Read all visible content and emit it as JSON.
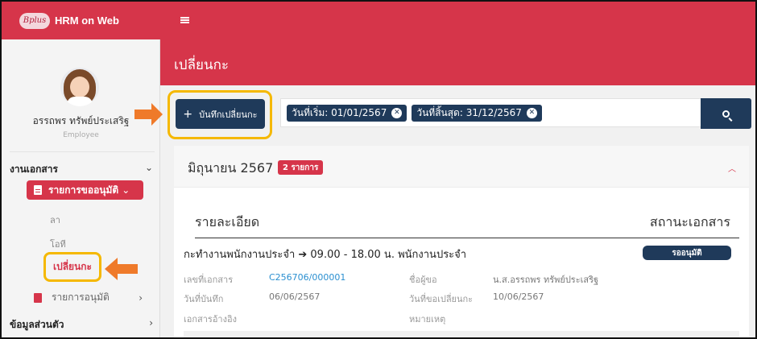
{
  "brand": {
    "logo_text": "Bplus",
    "app_name": "HRM on Web"
  },
  "user": {
    "name": "อรรถพร ทรัพย์ประเสริฐ",
    "role": "Employee"
  },
  "sidebar": {
    "section_documents": "งานเอกสาร",
    "documents_menu": {
      "label": "รายการขออนุมัติ",
      "items": [
        "ลา",
        "โอที",
        "เปลี่ยนกะ"
      ]
    },
    "approved_list": "รายการอนุมัติ",
    "section_personal": "ข้อมูลส่วนตัว"
  },
  "header": {
    "page_title": "เปลี่ยนกะ"
  },
  "toolbar": {
    "add_button": "บันทึกเปลี่ยนกะ",
    "filters": [
      "วันที่เริ่ม: 01/01/2567",
      "วันที่สิ้นสุด: 31/12/2567"
    ]
  },
  "month_group": {
    "title": "มิถุนายน 2567",
    "count_badge": "2 รายการ",
    "columns": {
      "detail": "รายละเอียด",
      "status": "สถานะเอกสาร"
    },
    "record": {
      "title": "กะทำงานพนักงานประจำ ➔ 09.00 - 18.00 น. พนักงานประจำ",
      "status": "รออนุมัติ",
      "doc_no_label": "เลขที่เอกสาร",
      "doc_no": "C256706/000001",
      "requester_label": "ชื่อผู้ขอ",
      "requester": "น.ส.อรรถพร ทรัพย์ประเสริฐ",
      "record_date_label": "วันที่บันทึก",
      "record_date": "06/06/2567",
      "change_date_label": "วันที่ขอเปลี่ยนกะ",
      "change_date": "10/06/2567",
      "ref_doc_label": "เอกสารอ้างอิง",
      "note_label": "หมายเหตุ"
    }
  },
  "colors": {
    "brand_red": "#d6354a",
    "navy": "#1f3a5a",
    "highlight_yellow": "#f5b800",
    "arrow_orange": "#ef7a2a"
  }
}
